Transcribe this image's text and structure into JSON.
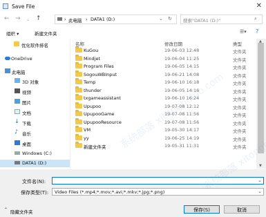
{
  "window": {
    "title": "Save File"
  },
  "nav": {
    "breadcrumb": [
      "此电脑",
      "DATA1 (D:)"
    ],
    "search_placeholder": "搜索\"DATA1 (D:)\""
  },
  "toolbar": {
    "organize": "组织 ▾",
    "new_folder": "新建文件夹"
  },
  "sidebar": {
    "items": [
      {
        "label": "优化软件排名",
        "icon": "folder-icon"
      },
      {
        "label": "OneDrive",
        "icon": "cloud-icon"
      },
      {
        "label": "此电脑",
        "icon": "computer-icon"
      },
      {
        "label": "3D 对象",
        "icon": "cube-icon"
      },
      {
        "label": "视频",
        "icon": "video-icon"
      },
      {
        "label": "图片",
        "icon": "picture-icon"
      },
      {
        "label": "文档",
        "icon": "document-icon"
      },
      {
        "label": "下载",
        "icon": "download-icon"
      },
      {
        "label": "音乐",
        "icon": "music-icon"
      },
      {
        "label": "桌面",
        "icon": "desktop-icon"
      },
      {
        "label": "Windows (C:)",
        "icon": "drive-icon"
      },
      {
        "label": "DATA1 (D:)",
        "icon": "drive-icon",
        "active": true
      }
    ]
  },
  "columns": {
    "name": "名称",
    "date": "修改日期",
    "type": "类型"
  },
  "files": [
    {
      "name": "KuGou",
      "date": "19-06-03 12:48",
      "type": "文件夹"
    },
    {
      "name": "Mindjet",
      "date": "19-06-04 11:25",
      "type": "文件夹"
    },
    {
      "name": "Program Files",
      "date": "19-06-05 14:15",
      "type": "文件夹"
    },
    {
      "name": "SogouWBInput",
      "date": "19-06-21 14:08",
      "type": "文件夹"
    },
    {
      "name": "Temp",
      "date": "19-06-10 16:18",
      "type": "文件夹"
    },
    {
      "name": "thunder",
      "date": "19-06-05 14:16",
      "type": "文件夹"
    },
    {
      "name": "txgameassistant",
      "date": "19-06-10 16:24",
      "type": "文件夹"
    },
    {
      "name": "Upupoo",
      "date": "19-07-08 12:12",
      "type": "文件夹"
    },
    {
      "name": "UpupooGame",
      "date": "19-07-08 11:56",
      "type": "文件夹"
    },
    {
      "name": "UpupooResource",
      "date": "19-07-08 11:56",
      "type": "文件夹"
    },
    {
      "name": "VM",
      "date": "19-05-30 14:17",
      "type": "文件夹"
    },
    {
      "name": "yy",
      "date": "19-06-25 14:19",
      "type": "文件夹"
    },
    {
      "name": "新建文件夹",
      "date": "19-05-31 11:31",
      "type": "文件夹"
    }
  ],
  "form": {
    "filename_label": "文件名(N):",
    "filename_value": "",
    "filetype_label": "保存类型(T):",
    "filetype_value": "Video Files (*.mp4;*.mov;*.avi;*.mkv;*.jpg;*.png)"
  },
  "footer": {
    "hide_folders": "隐藏文件夹",
    "save": "保存(S)",
    "cancel": "取消"
  },
  "watermark": "系统部落 xitongbuluo.com"
}
